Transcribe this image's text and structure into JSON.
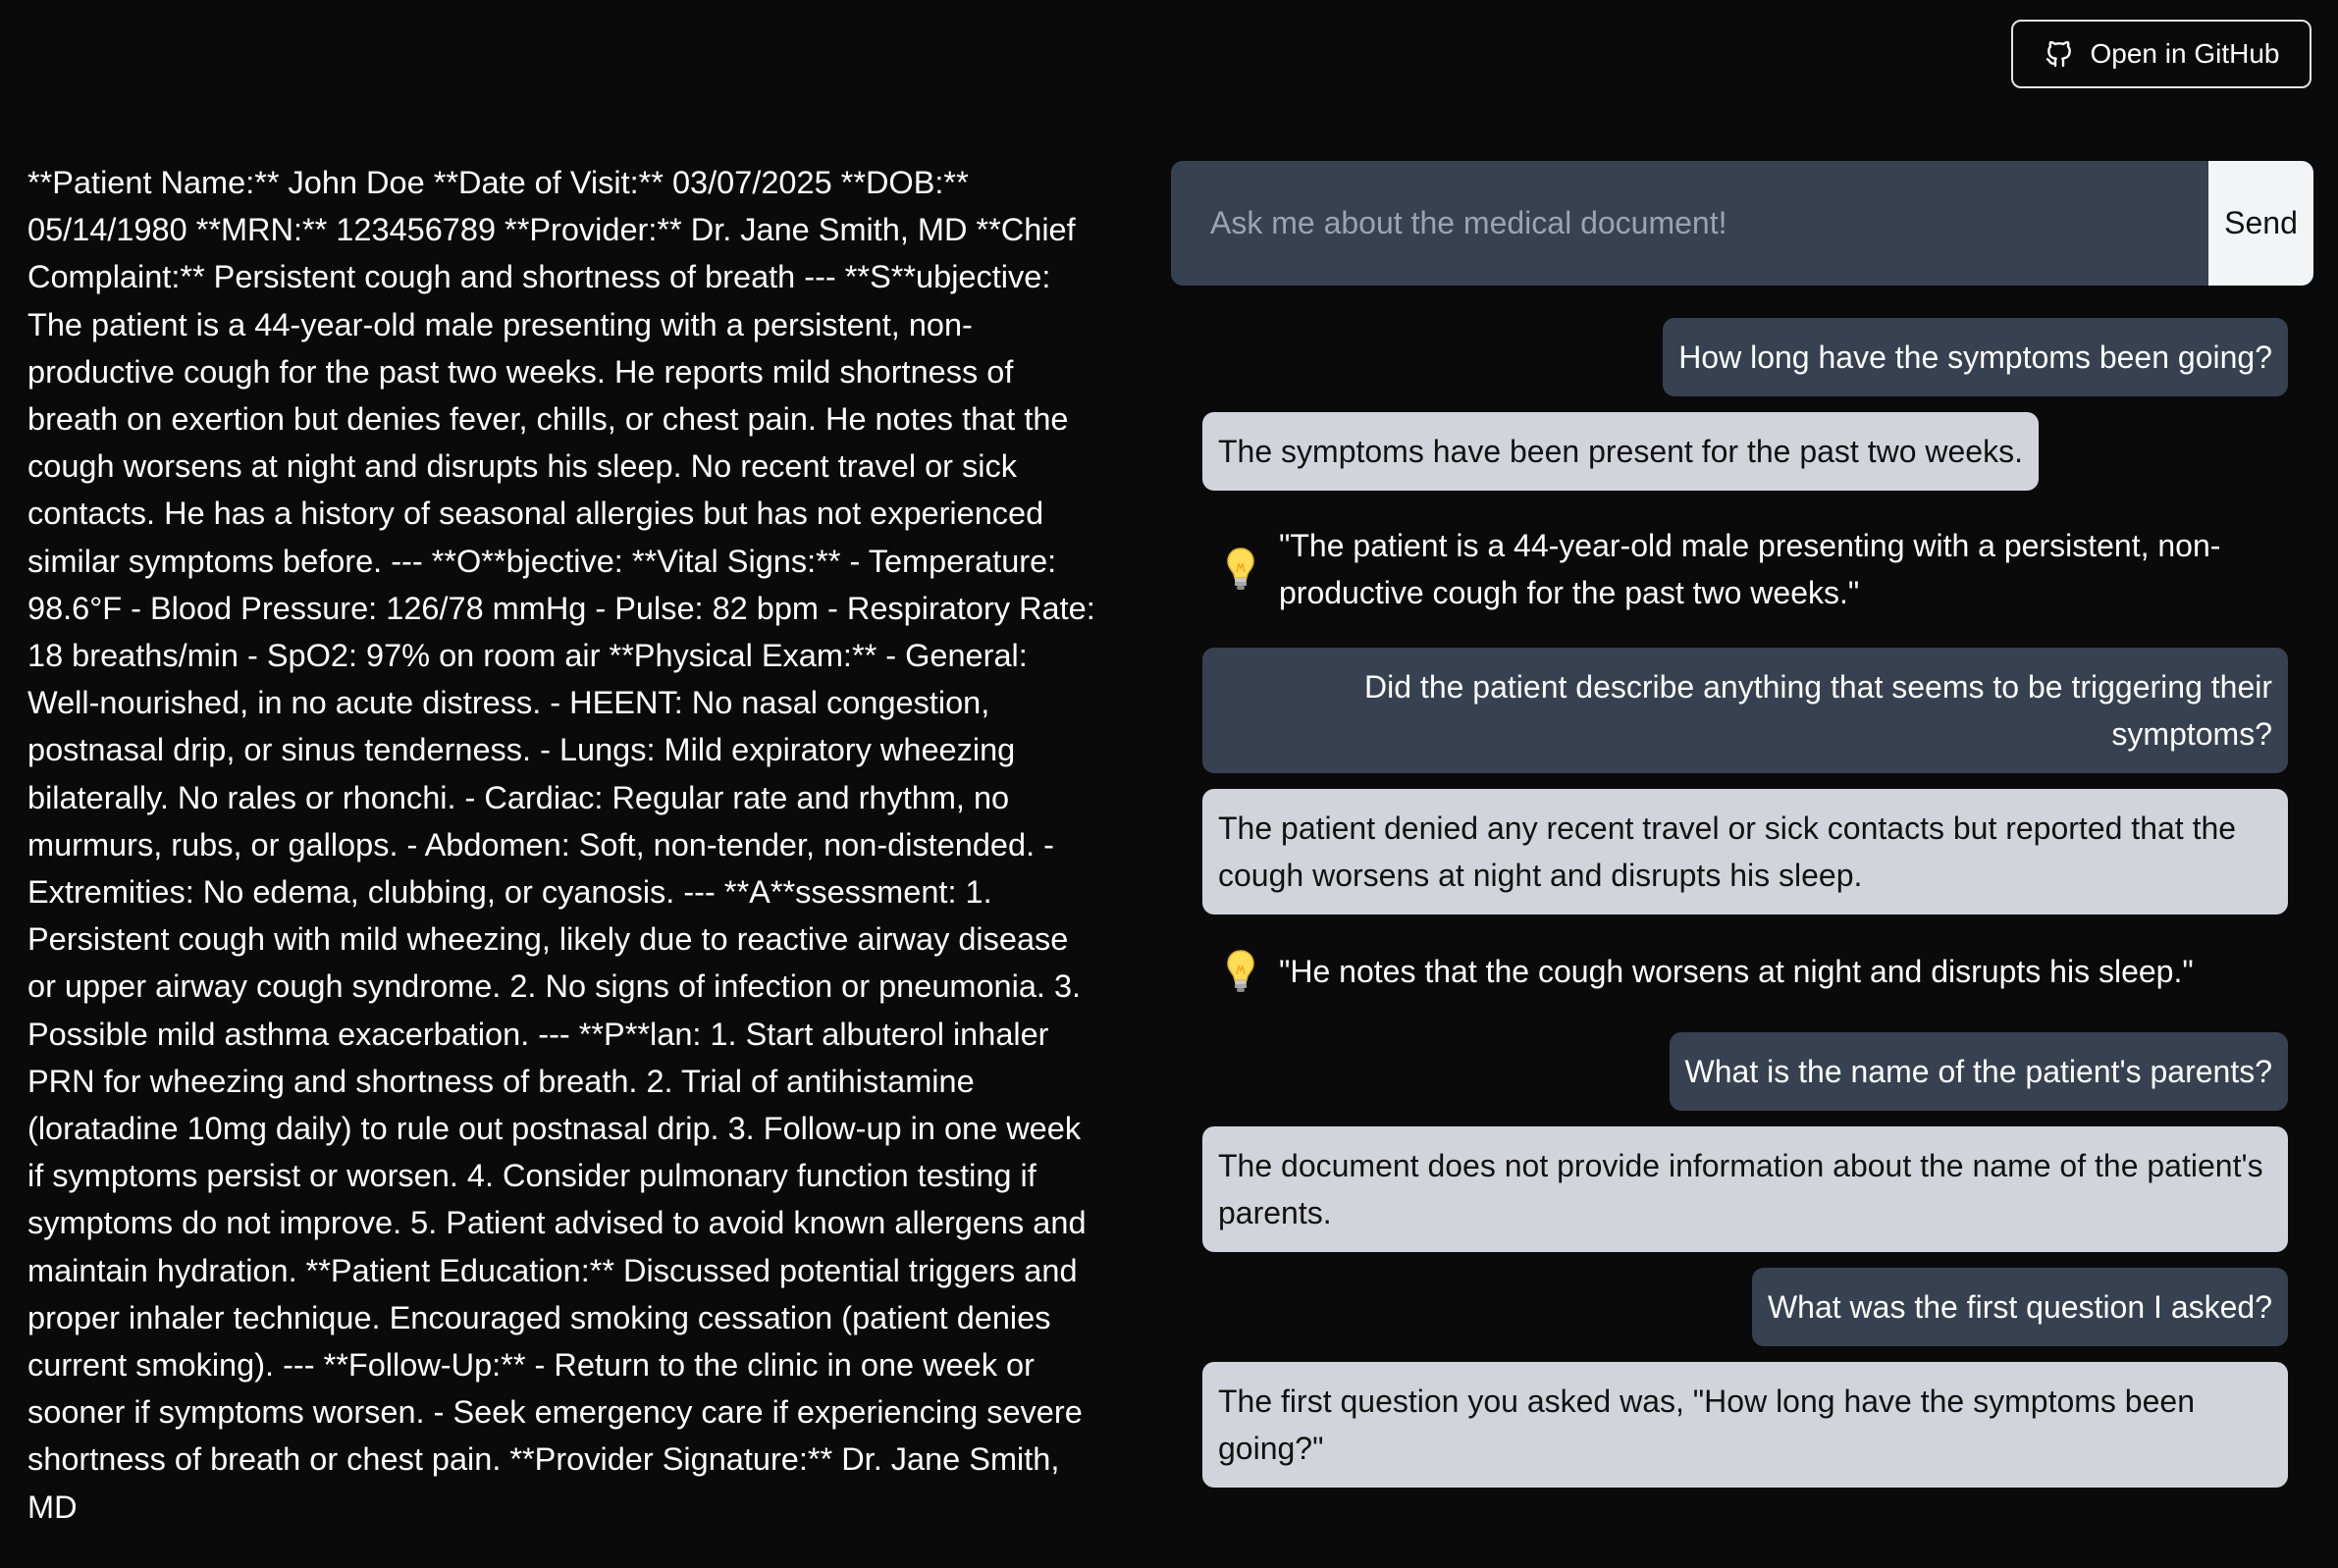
{
  "header": {
    "github_label": "Open in GitHub"
  },
  "document": {
    "text": "**Patient Name:** John Doe **Date of Visit:** 03/07/2025 **DOB:** 05/14/1980 **MRN:** 123456789 **Provider:** Dr. Jane Smith, MD **Chief Complaint:** Persistent cough and shortness of breath --- **S**ubjective: The patient is a 44-year-old male presenting with a persistent, non-productive cough for the past two weeks. He reports mild shortness of breath on exertion but denies fever, chills, or chest pain. He notes that the cough worsens at night and disrupts his sleep. No recent travel or sick contacts. He has a history of seasonal allergies but has not experienced similar symptoms before. --- **O**bjective: **Vital Signs:** - Temperature: 98.6°F - Blood Pressure: 126/78 mmHg - Pulse: 82 bpm - Respiratory Rate: 18 breaths/min - SpO2: 97% on room air **Physical Exam:** - General: Well-nourished, in no acute distress. - HEENT: No nasal congestion, postnasal drip, or sinus tenderness. - Lungs: Mild expiratory wheezing bilaterally. No rales or rhonchi. - Cardiac: Regular rate and rhythm, no murmurs, rubs, or gallops. - Abdomen: Soft, non-tender, non-distended. - Extremities: No edema, clubbing, or cyanosis. --- **A**ssessment: 1. Persistent cough with mild wheezing, likely due to reactive airway disease or upper airway cough syndrome. 2. No signs of infection or pneumonia. 3. Possible mild asthma exacerbation. --- **P**lan: 1. Start albuterol inhaler PRN for wheezing and shortness of breath. 2. Trial of antihistamine (loratadine 10mg daily) to rule out postnasal drip. 3. Follow-up in one week if symptoms persist or worsen. 4. Consider pulmonary function testing if symptoms do not improve. 5. Patient advised to avoid known allergens and maintain hydration. **Patient Education:** Discussed potential triggers and proper inhaler technique. Encouraged smoking cessation (patient denies current smoking). --- **Follow-Up:** - Return to the clinic in one week or sooner if symptoms worsen. - Seek emergency care if experiencing severe shortness of breath or chest pain. **Provider Signature:** Dr. Jane Smith, MD"
  },
  "chat": {
    "placeholder": "Ask me about the medical document!",
    "input_value": "",
    "send_label": "Send",
    "messages": [
      {
        "role": "user",
        "text": "How long have the symptoms been going?"
      },
      {
        "role": "bot",
        "text": "The symptoms have been present for the past two weeks."
      },
      {
        "role": "citation",
        "icon": "lightbulb-icon",
        "text": "\"The patient is a 44-year-old male presenting with a persistent, non-productive cough for the past two weeks.\""
      },
      {
        "role": "user",
        "text": "Did the patient describe anything that seems to be triggering their symptoms?"
      },
      {
        "role": "bot",
        "text": "The patient denied any recent travel or sick contacts but reported that the cough worsens at night and disrupts his sleep."
      },
      {
        "role": "citation",
        "icon": "lightbulb-icon",
        "text": "\"He notes that the cough worsens at night and disrupts his sleep.\""
      },
      {
        "role": "user",
        "text": "What is the name of the patient's parents?"
      },
      {
        "role": "bot",
        "text": "The document does not provide information about the name of the patient's parents."
      },
      {
        "role": "user",
        "text": "What was the first question I asked?"
      },
      {
        "role": "bot",
        "text": "The first question you asked was, \"How long have the symptoms been going?\""
      }
    ]
  },
  "colors": {
    "background": "#0a0a0a",
    "user_bubble": "#374151",
    "bot_bubble": "#d1d5db",
    "send_button": "#f3f4f6"
  }
}
